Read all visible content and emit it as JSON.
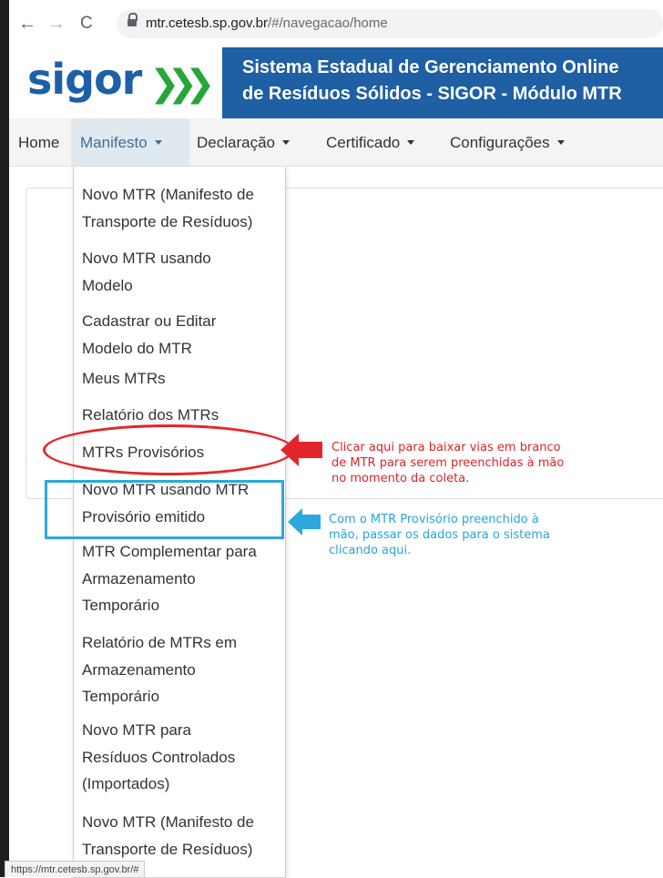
{
  "browser": {
    "url_host": "mtr.cetesb.sp.gov.br",
    "url_path": "/#/navegacao/home",
    "back_icon": "←",
    "forward_icon": "→",
    "reload_icon": "C"
  },
  "header": {
    "logo_text": "sigor",
    "logo_arrows": "❯❯❯",
    "title_line1": "Sistema Estadual de Gerenciamento Online",
    "title_line2": "de Resíduos Sólidos - SIGOR - Módulo MTR",
    "band_color": "#1f5fa3"
  },
  "navbar": {
    "home": "Home",
    "manifesto": "Manifesto",
    "declaracao": "Declaração",
    "certificado": "Certificado",
    "configuracoes": "Configurações"
  },
  "dropdown": {
    "items": [
      {
        "line1": "Novo MTR (Manifesto de",
        "line2": "Transporte de Resíduos)"
      },
      {
        "line1": "Novo MTR usando",
        "line2": "Modelo"
      },
      {
        "line1": "Cadastrar ou Editar",
        "line2": "Modelo do MTR"
      },
      {
        "line1": "Meus MTRs"
      },
      {
        "line1": "Relatório dos MTRs"
      },
      {
        "line1": "MTRs Provisórios"
      },
      {
        "line1": "Novo MTR usando MTR",
        "line2": "Provisório emitido"
      },
      {
        "line1": "MTR Complementar para",
        "line2": "Armazenamento",
        "line3": "Temporário"
      },
      {
        "line1": "Relatório de MTRs em",
        "line2": "Armazenamento",
        "line3": "Temporário"
      },
      {
        "line1": "Novo MTR para",
        "line2": "Resíduos Controlados",
        "line3": "(Importados)"
      },
      {
        "line1": "Novo MTR (Manifesto de",
        "line2": "Transporte de Resíduos)"
      }
    ]
  },
  "annotations": {
    "red_note": [
      "Clicar aqui para baixar vias em branco",
      "de MTR para serem preenchidas à mão",
      "no momento da coleta."
    ],
    "blue_note": [
      "Com o MTR Provisório preenchido à",
      "mão, passar os dados para o sistema",
      "clicando aqui."
    ],
    "red_color": "#e3262b",
    "blue_color": "#2da8dc"
  },
  "status_bar": {
    "text": "https://mtr.cetesb.sp.gov.br/#"
  }
}
